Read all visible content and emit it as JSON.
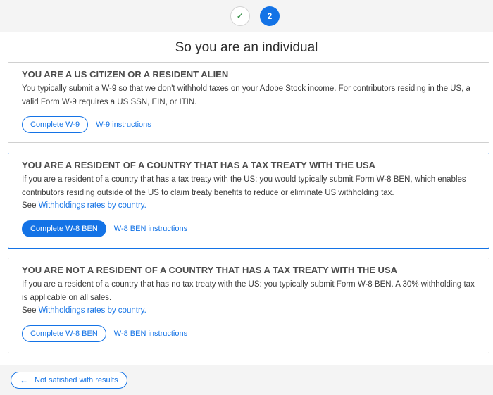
{
  "stepper": {
    "step1_symbol": "✓",
    "step2_label": "2"
  },
  "page_title": "So you are an individual",
  "cards": [
    {
      "title": "YOU ARE A US CITIZEN OR A RESIDENT ALIEN",
      "body": "You typically submit a W-9 so that we don't withhold taxes on your Adobe Stock income. For contributors residing in the US, a valid Form W-9 requires a US SSN, EIN, or ITIN.",
      "button_label": "Complete W-9",
      "link_label": "W-9 instructions"
    },
    {
      "title": "YOU ARE A RESIDENT OF A COUNTRY THAT HAS A TAX TREATY WITH THE USA",
      "body": "If you are a resident of a country that has a tax treaty with the US: you would typically submit Form W-8 BEN, which enables contributors residing outside of the US to claim treaty benefits to reduce or eliminate US withholding tax.",
      "see_prefix": "See ",
      "see_link": "Withholdings rates by country.",
      "button_label": "Complete W-8 BEN",
      "link_label": "W-8 BEN instructions"
    },
    {
      "title": "YOU ARE NOT A RESIDENT OF A COUNTRY THAT HAS A TAX TREATY WITH THE USA",
      "body": "If you are a resident of a country that has no tax treaty with the US: you typically submit Form W-8 BEN. A 30% withholding tax is applicable on all sales.",
      "see_prefix": "See ",
      "see_link": "Withholdings rates by country.",
      "button_label": "Complete W-8 BEN",
      "link_label": "W-8 BEN instructions"
    }
  ],
  "footer": {
    "back_arrow": "←",
    "back_label": "Not satisfied with results"
  },
  "colors": {
    "accent": "#1473e6",
    "check": "#2d8a3e",
    "background_band": "#f4f4f4"
  }
}
